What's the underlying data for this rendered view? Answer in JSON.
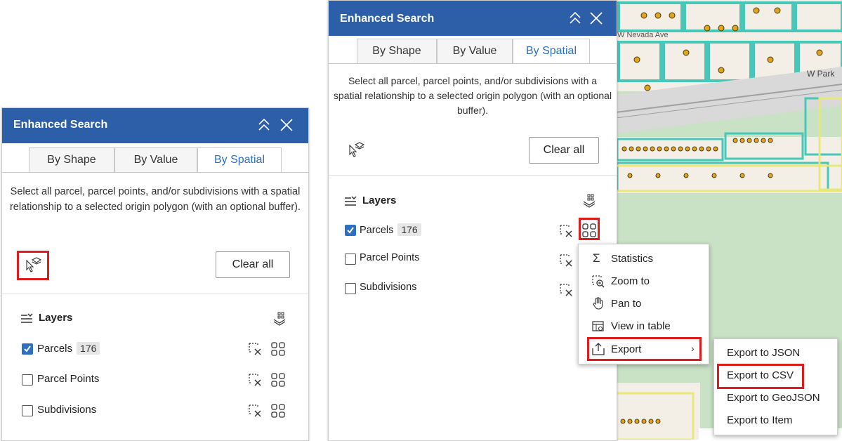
{
  "left_panel": {
    "title": "Enhanced Search",
    "tabs": [
      "By Shape",
      "By Value",
      "By Spatial"
    ],
    "description": "Select all parcel, parcel points, and/or subdivisions with a spatial relationship to a selected origin polygon (with an optional buffer).",
    "clear_label": "Clear all",
    "layers_header": "Layers",
    "layers": [
      {
        "label": "Parcels",
        "count": "176",
        "checked": true
      },
      {
        "label": "Parcel Points",
        "checked": false
      },
      {
        "label": "Subdivisions",
        "checked": false
      }
    ]
  },
  "right_panel": {
    "title": "Enhanced Search",
    "tabs": [
      "By Shape",
      "By Value",
      "By Spatial"
    ],
    "description": "Select all parcel, parcel points, and/or subdivisions with a spatial relationship to a selected origin polygon (with an optional buffer).",
    "clear_label": "Clear all",
    "layers_header": "Layers",
    "layers": [
      {
        "label": "Parcels",
        "count": "176",
        "checked": true
      },
      {
        "label": "Parcel Points",
        "checked": false
      },
      {
        "label": "Subdivisions",
        "checked": false
      }
    ]
  },
  "context_menu": {
    "items": [
      "Statistics",
      "Zoom to",
      "Pan to",
      "View in table",
      "Export"
    ]
  },
  "export_submenu": {
    "items": [
      "Export to JSON",
      "Export to CSV",
      "Export to GeoJSON",
      "Export to Item"
    ]
  },
  "map": {
    "street_labels": [
      "W Nevada Ave",
      "W Park"
    ]
  },
  "colors": {
    "header_blue": "#2d5fa8",
    "active_tab_text": "#2d6fc0",
    "highlight_red": "#e01b1b",
    "parcel_outline": "#46c7b8",
    "parcel_point": "#e0a51a"
  }
}
